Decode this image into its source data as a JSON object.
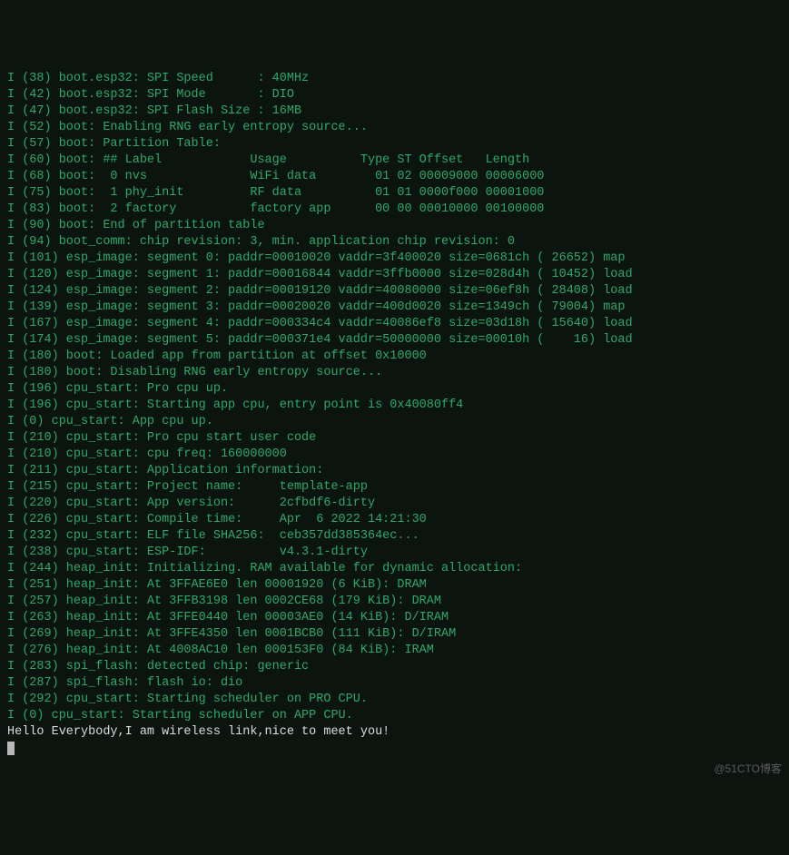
{
  "lines": [
    "I (38) boot.esp32: SPI Speed      : 40MHz",
    "I (42) boot.esp32: SPI Mode       : DIO",
    "I (47) boot.esp32: SPI Flash Size : 16MB",
    "I (52) boot: Enabling RNG early entropy source...",
    "I (57) boot: Partition Table:",
    "I (60) boot: ## Label            Usage          Type ST Offset   Length",
    "I (68) boot:  0 nvs              WiFi data        01 02 00009000 00006000",
    "I (75) boot:  1 phy_init         RF data          01 01 0000f000 00001000",
    "I (83) boot:  2 factory          factory app      00 00 00010000 00100000",
    "I (90) boot: End of partition table",
    "I (94) boot_comm: chip revision: 3, min. application chip revision: 0",
    "I (101) esp_image: segment 0: paddr=00010020 vaddr=3f400020 size=0681ch ( 26652) map",
    "I (120) esp_image: segment 1: paddr=00016844 vaddr=3ffb0000 size=028d4h ( 10452) load",
    "I (124) esp_image: segment 2: paddr=00019120 vaddr=40080000 size=06ef8h ( 28408) load",
    "I (139) esp_image: segment 3: paddr=00020020 vaddr=400d0020 size=1349ch ( 79004) map",
    "I (167) esp_image: segment 4: paddr=000334c4 vaddr=40086ef8 size=03d18h ( 15640) load",
    "I (174) esp_image: segment 5: paddr=000371e4 vaddr=50000000 size=00010h (    16) load",
    "I (180) boot: Loaded app from partition at offset 0x10000",
    "I (180) boot: Disabling RNG early entropy source...",
    "I (196) cpu_start: Pro cpu up.",
    "I (196) cpu_start: Starting app cpu, entry point is 0x40080ff4",
    "I (0) cpu_start: App cpu up.",
    "I (210) cpu_start: Pro cpu start user code",
    "I (210) cpu_start: cpu freq: 160000000",
    "I (211) cpu_start: Application information:",
    "I (215) cpu_start: Project name:     template-app",
    "I (220) cpu_start: App version:      2cfbdf6-dirty",
    "I (226) cpu_start: Compile time:     Apr  6 2022 14:21:30",
    "I (232) cpu_start: ELF file SHA256:  ceb357dd385364ec...",
    "I (238) cpu_start: ESP-IDF:          v4.3.1-dirty",
    "I (244) heap_init: Initializing. RAM available for dynamic allocation:",
    "I (251) heap_init: At 3FFAE6E0 len 00001920 (6 KiB): DRAM",
    "I (257) heap_init: At 3FFB3198 len 0002CE68 (179 KiB): DRAM",
    "I (263) heap_init: At 3FFE0440 len 00003AE0 (14 KiB): D/IRAM",
    "I (269) heap_init: At 3FFE4350 len 0001BCB0 (111 KiB): D/IRAM",
    "I (276) heap_init: At 4008AC10 len 000153F0 (84 KiB): IRAM",
    "I (283) spi_flash: detected chip: generic",
    "I (287) spi_flash: flash io: dio",
    "I (292) cpu_start: Starting scheduler on PRO CPU.",
    "I (0) cpu_start: Starting scheduler on APP CPU."
  ],
  "message": "Hello Everybody,I am wireless link,nice to meet you!",
  "watermark": "@51CTO博客"
}
